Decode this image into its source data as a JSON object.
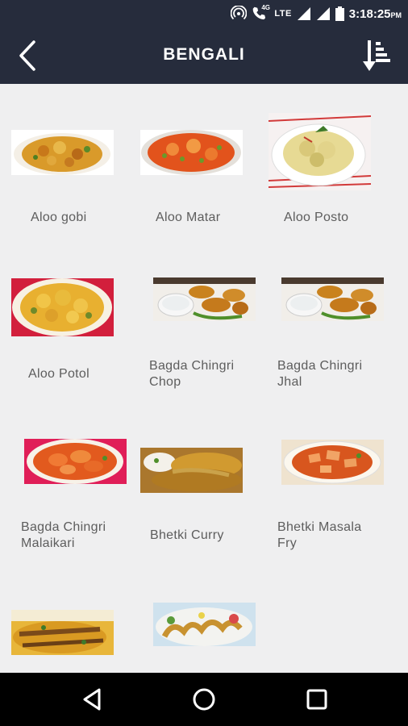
{
  "status_bar": {
    "network": "4G",
    "network_type": "LTE",
    "time": "3:18:25",
    "ampm": "PM"
  },
  "app_bar": {
    "title": "BENGALI",
    "back_icon": "chevron-left-icon",
    "sort_icon": "sort-icon"
  },
  "colors": {
    "header_bg": "#262c3c",
    "page_bg": "#efeff0",
    "label_text": "#5d5d5d",
    "nav_bg": "#000000"
  },
  "recipes": [
    {
      "name": "Aloo gobi"
    },
    {
      "name": "Aloo Matar"
    },
    {
      "name": "Aloo Posto"
    },
    {
      "name": "Aloo Potol"
    },
    {
      "name": "Bagda Chingri Chop"
    },
    {
      "name": "Bagda Chingri Jhal"
    },
    {
      "name": "Bagda Chingri Malaikari"
    },
    {
      "name": "Bhetki Curry"
    },
    {
      "name": "Bhetki Masala Fry"
    },
    {
      "name": ""
    },
    {
      "name": ""
    }
  ],
  "nav_bar": {
    "back": "back-triangle-icon",
    "home": "home-circle-icon",
    "recents": "recents-square-icon"
  }
}
